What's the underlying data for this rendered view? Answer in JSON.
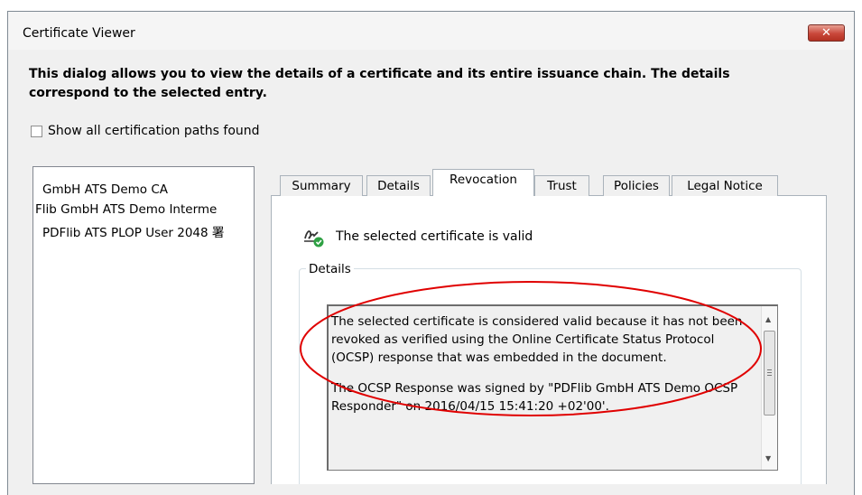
{
  "window": {
    "title": "Certificate Viewer",
    "close_icon": "close-icon"
  },
  "intro": "This dialog allows you to view the details of a certificate and its entire issuance chain. The details correspond to the selected entry.",
  "show_all_paths": {
    "label": "Show all certification paths found",
    "checked": false
  },
  "cert_tree": {
    "items": [
      {
        "label": "GmbH ATS Demo CA"
      },
      {
        "label": "Flib GmbH ATS Demo Interme"
      },
      {
        "label": "PDFlib ATS PLOP User 2048 署"
      }
    ]
  },
  "tabs": [
    {
      "label": "Summary",
      "active": false
    },
    {
      "label": "Details",
      "active": false
    },
    {
      "label": "Revocation",
      "active": true
    },
    {
      "label": "Trust",
      "active": false
    },
    {
      "label": "Policies",
      "active": false
    },
    {
      "label": "Legal Notice",
      "active": false
    }
  ],
  "revocation": {
    "status_icon": "signature-valid-icon",
    "status_text": "The selected certificate is valid",
    "details_legend": "Details",
    "details_paragraphs": [
      "The selected certificate is considered valid because it has not been revoked as verified using the Online Certificate Status Protocol (OCSP) response that was embedded in the document.",
      "The OCSP Response was signed by \"PDFlib GmbH ATS Demo OCSP Responder\" on 2016/04/15 15:41:20 +02'00'."
    ]
  },
  "colors": {
    "annotation": "#e00000",
    "close_button": "#c9473a",
    "valid_check": "#2ea043"
  }
}
